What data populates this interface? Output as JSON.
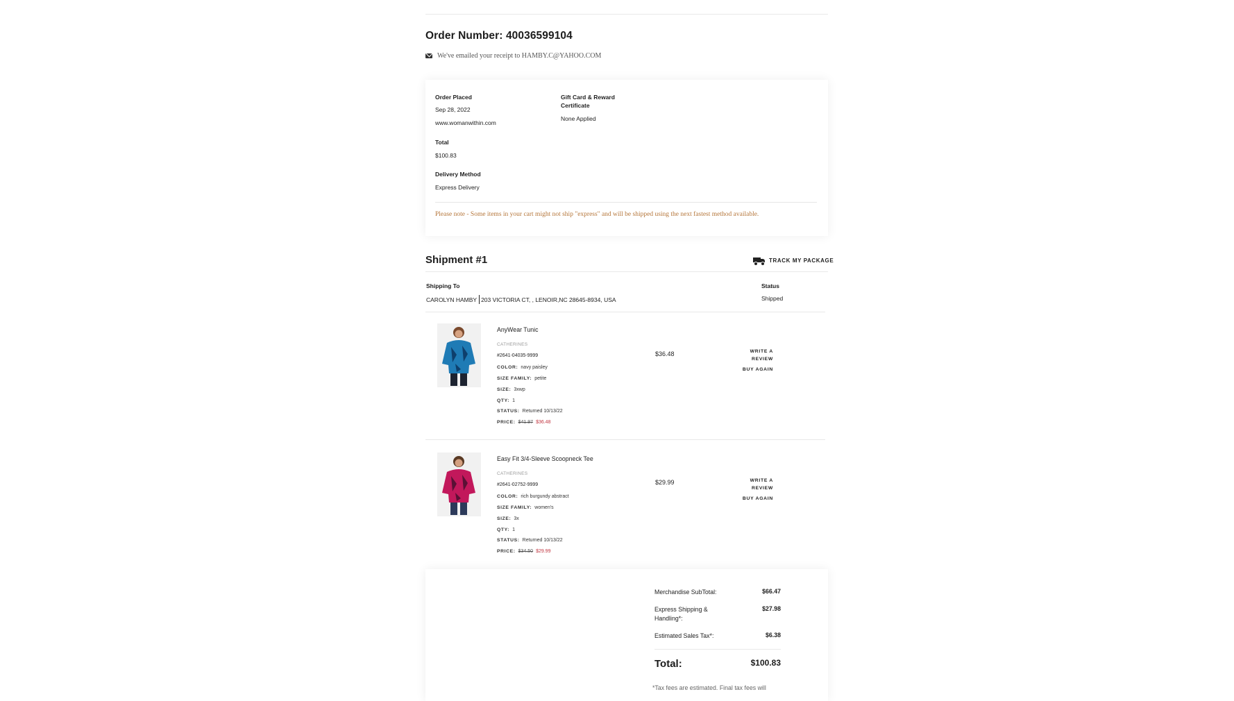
{
  "order": {
    "title": "Order Number: 40036599104",
    "email_note": "We've emailed your receipt to HAMBY.C@YAHOO.COM"
  },
  "summary": {
    "order_placed_label": "Order Placed",
    "order_date": "Sep 28, 2022",
    "site": "www.womanwithin.com",
    "total_label": "Total",
    "total_value": "$100.83",
    "delivery_label": "Delivery Method",
    "delivery_value": "Express Delivery",
    "gift_label_line1": "Gift Card & Reward",
    "gift_label_line2": "Certificate",
    "gift_value": "None Applied",
    "note": "Please note - Some items in your cart might not ship \"express\" and will be shipped using the next fastest method available."
  },
  "shipment": {
    "title": "Shipment #1",
    "track_label": "TRACK MY PACKAGE",
    "shipping_to_label": "Shipping To",
    "recipient": "CAROLYN HAMBY",
    "address": "203 VICTORIA CT,  ,  LENOIR,NC 28645-8934,  USA",
    "status_label": "Status",
    "status_value": "Shipped"
  },
  "items": [
    {
      "name": "AnyWear Tunic",
      "brand": "CATHERINES",
      "sku": "#2641-04035-9999",
      "color_label": "COLOR:",
      "color": "navy paisley",
      "size_family_label": "SIZE FAMILY:",
      "size_family": "petite",
      "size_label": "SIZE:",
      "size": "3xwp",
      "qty_label": "QTY:",
      "qty": "1",
      "status_label": "STATUS:",
      "status": "Returned 10/13/22",
      "price_label": "PRICE:",
      "price_original": "$41.97",
      "price_sale": "$36.48",
      "line_price": "$36.48",
      "review_line1": "WRITE A",
      "review_line2": "REVIEW",
      "buy_again": "BUY AGAIN",
      "shirt_color": "#1f7bb5",
      "shirt_accent": "#0e3f6c"
    },
    {
      "name": "Easy Fit 3/4-Sleeve Scoopneck Tee",
      "brand": "CATHERINES",
      "sku": "#2641-02752-9999",
      "color_label": "COLOR:",
      "color": "rich burgundy abstract",
      "size_family_label": "SIZE FAMILY:",
      "size_family": "women's",
      "size_label": "SIZE:",
      "size": "3x",
      "qty_label": "QTY:",
      "qty": "1",
      "status_label": "STATUS:",
      "status": "Returned 10/13/22",
      "price_label": "PRICE:",
      "price_original": "$34.50",
      "price_sale": "$29.99",
      "line_price": "$29.99",
      "review_line1": "WRITE A",
      "review_line2": "REVIEW",
      "buy_again": "BUY AGAIN",
      "shirt_color": "#c2185b",
      "shirt_accent": "#5a1035"
    }
  ],
  "totals": {
    "subtotal_label": "Merchandise SubTotal:",
    "subtotal_value": "$66.47",
    "shipping_label_line1": "Express Shipping &",
    "shipping_label_line2": "Handling*:",
    "shipping_value": "$27.98",
    "tax_label": "Estimated Sales Tax*:",
    "tax_value": "$6.38",
    "grand_label": "Total:",
    "grand_value": "$100.83",
    "footnote": "*Tax fees are estimated. Final tax fees will"
  }
}
